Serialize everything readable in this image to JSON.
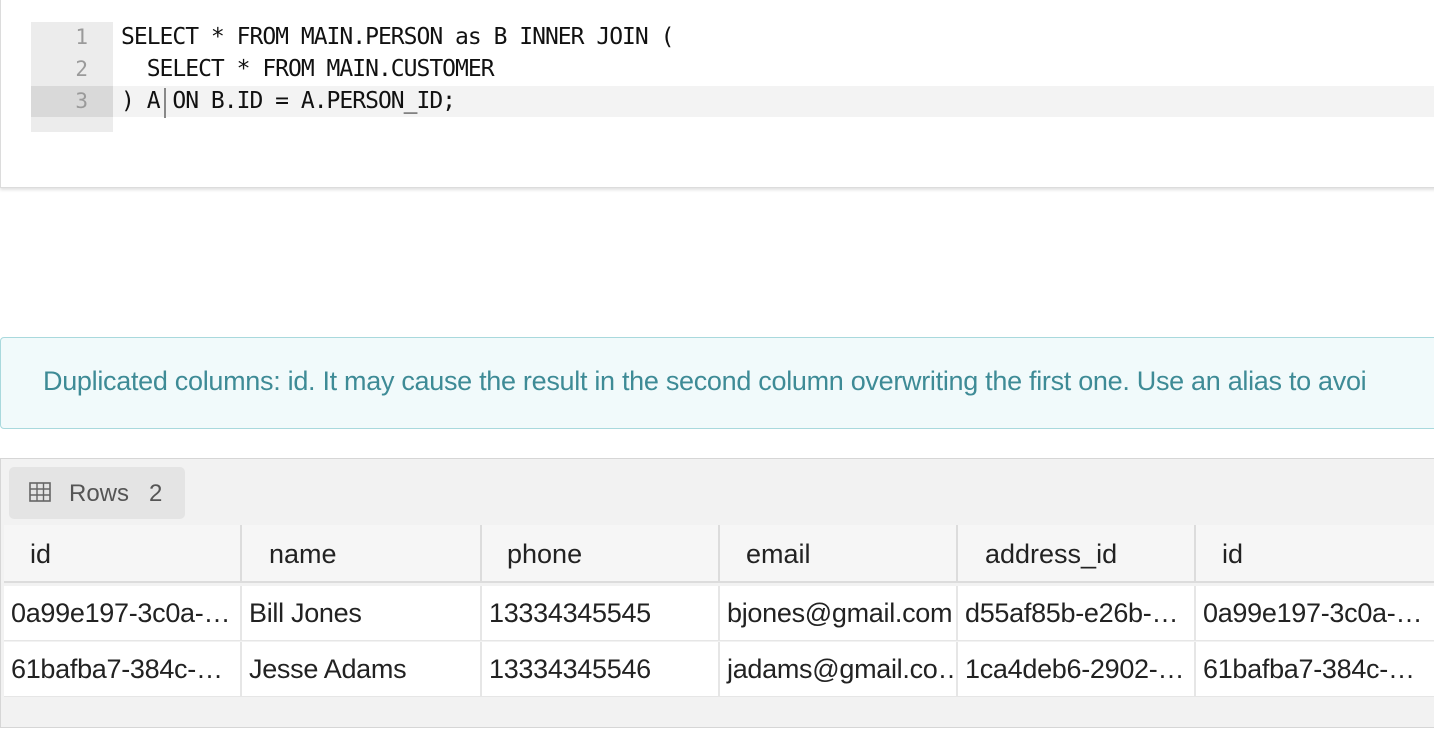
{
  "editor": {
    "lines": [
      {
        "num": "1",
        "code": "SELECT * FROM MAIN.PERSON as B INNER JOIN ("
      },
      {
        "num": "2",
        "code": "  SELECT * FROM MAIN.CUSTOMER"
      },
      {
        "num": "3",
        "code": ") A ON B.ID = A.PERSON_ID;"
      }
    ]
  },
  "warning": {
    "text": "Duplicated columns: id. It may cause the result in the second column overwriting the first one. Use an alias to avoi"
  },
  "results": {
    "tab_icon": "table-icon",
    "tab_label": "Rows",
    "tab_count": "2",
    "columns": [
      "id",
      "name",
      "phone",
      "email",
      "address_id",
      "id"
    ],
    "rows": [
      [
        "0a99e197-3c0a-…",
        "Bill Jones",
        "13334345545",
        "bjones@gmail.com",
        "d55af85b-e26b-…",
        "0a99e197-3c0a-…"
      ],
      [
        "61bafba7-384c-…",
        "Jesse Adams",
        "13334345546",
        "jadams@gmail.co…",
        "1ca4deb6-2902-…",
        "61bafba7-384c-…"
      ]
    ]
  }
}
